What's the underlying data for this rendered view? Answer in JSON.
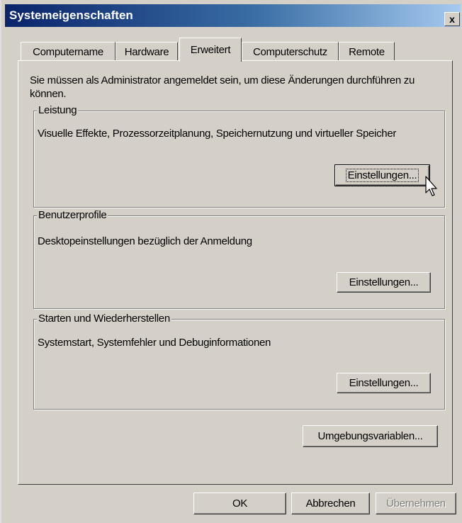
{
  "window": {
    "title": "Systemeigenschaften",
    "close_glyph": "x"
  },
  "tabs": [
    {
      "label": "Computername"
    },
    {
      "label": "Hardware"
    },
    {
      "label": "Erweitert"
    },
    {
      "label": "Computerschutz"
    },
    {
      "label": "Remote"
    }
  ],
  "active_tab": "Erweitert",
  "notice": "Sie müssen als Administrator angemeldet sein, um diese Änderungen durchführen zu können.",
  "groups": {
    "performance": {
      "title": "Leistung",
      "description": "Visuelle Effekte, Prozessorzeitplanung, Speichernutzung und virtueller Speicher",
      "button": "Einstellungen..."
    },
    "user_profiles": {
      "title": "Benutzerprofile",
      "description": "Desktopeinstellungen bezüglich der Anmeldung",
      "button": "Einstellungen..."
    },
    "startup_recovery": {
      "title": "Starten und Wiederherstellen",
      "description": "Systemstart, Systemfehler und Debuginformationen",
      "button": "Einstellungen..."
    }
  },
  "env_button": "Umgebungsvariablen...",
  "footer": {
    "ok": "OK",
    "cancel": "Abbrechen",
    "apply": "Übernehmen"
  },
  "icons": {
    "cursor": "arrow-cursor-icon"
  },
  "colors": {
    "titlebar_start": "#0a246a",
    "titlebar_end": "#a6caf0",
    "face": "#d4d0c8"
  }
}
